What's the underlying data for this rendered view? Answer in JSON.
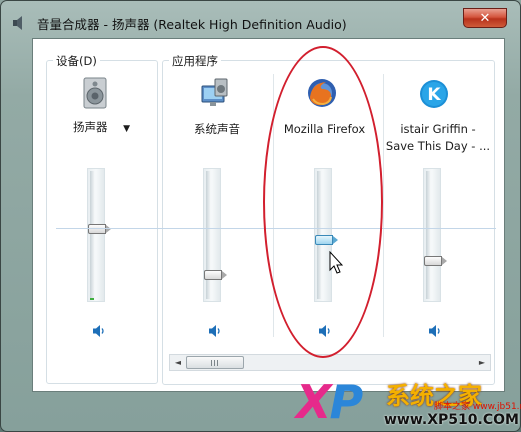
{
  "window": {
    "title": "音量合成器 - 扬声器 (Realtek High Definition Audio)",
    "close_symbol": "✕"
  },
  "devices": {
    "label": "设备(D)",
    "channel": {
      "name": "扬声器",
      "dropdown": "▼",
      "icon": "speaker-icon",
      "volume_level": 0.56,
      "muted": false
    }
  },
  "applications": {
    "label": "应用程序",
    "channels": [
      {
        "name": "系统声音",
        "icon": "system-sounds-icon",
        "volume_level": 0.2,
        "muted": false
      },
      {
        "name": "Mozilla Firefox",
        "icon": "firefox-icon",
        "volume_level": 0.48,
        "muted": false,
        "active": true
      },
      {
        "name": "istair Griffin - Save This Day - ...",
        "icon": "kmplayer-icon",
        "volume_level": 0.32,
        "muted": false
      }
    ]
  },
  "scrollbar": {
    "left_arrow": "◄",
    "right_arrow": "►"
  },
  "watermark": {
    "logo": "XP",
    "brand": "系统之家",
    "sub": "脚本之家",
    "sub_url": "www.jb51.net",
    "url": "www.XP510.COM"
  },
  "colors": {
    "highlight_circle": "#d21f2e",
    "active_thumb": "#9fd5ef",
    "mute_icon": "#1d6fb8"
  }
}
